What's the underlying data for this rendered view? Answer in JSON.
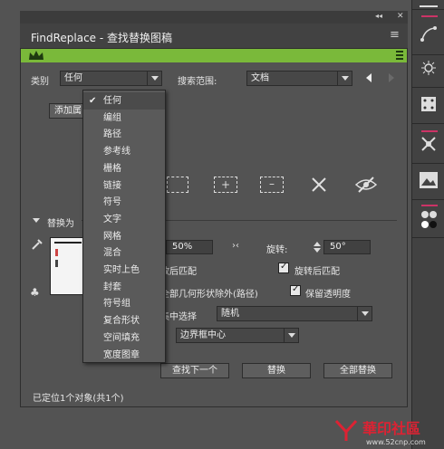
{
  "panel": {
    "title": "FindReplace - 查找替换图稿",
    "collapse_glyph": "◂◂",
    "close_glyph": "✕",
    "menu_glyph": "≡"
  },
  "filter": {
    "category_label": "类别",
    "category_value": "任何",
    "scope_label": "搜索范围:",
    "scope_value": "文档"
  },
  "add_button": "添加属",
  "category_options": [
    {
      "label": "任何",
      "selected": true
    },
    {
      "label": "编组"
    },
    {
      "label": "路径"
    },
    {
      "label": "参考线"
    },
    {
      "label": "栅格"
    },
    {
      "label": "链接"
    },
    {
      "label": "符号"
    },
    {
      "label": "文字"
    },
    {
      "label": "网格"
    },
    {
      "label": "混合"
    },
    {
      "label": "实时上色"
    },
    {
      "label": "封套"
    },
    {
      "label": "符号组"
    },
    {
      "label": "复合形状"
    },
    {
      "label": "空间填充"
    },
    {
      "label": "宽度图章"
    }
  ],
  "replace": {
    "section_label": "替换为",
    "scale_value": "50%",
    "rotate_label": "旋转:",
    "rotate_value": "50°",
    "scale_after_match": "放后匹配",
    "rotate_after_match": "旋转后匹配",
    "exclude_label": "全部几何形状除外(路径)",
    "keep_transparency": "保留透明度",
    "select_label": "集中选择",
    "select_value": "随机",
    "align_value": "边界框中心"
  },
  "actions": {
    "find_next": "查找下一个",
    "replace": "替换",
    "replace_all": "全部替换"
  },
  "status": "已定位1个对象(共1个)",
  "watermark": {
    "brand": "華印社區",
    "url": "www.52cnp.com"
  }
}
